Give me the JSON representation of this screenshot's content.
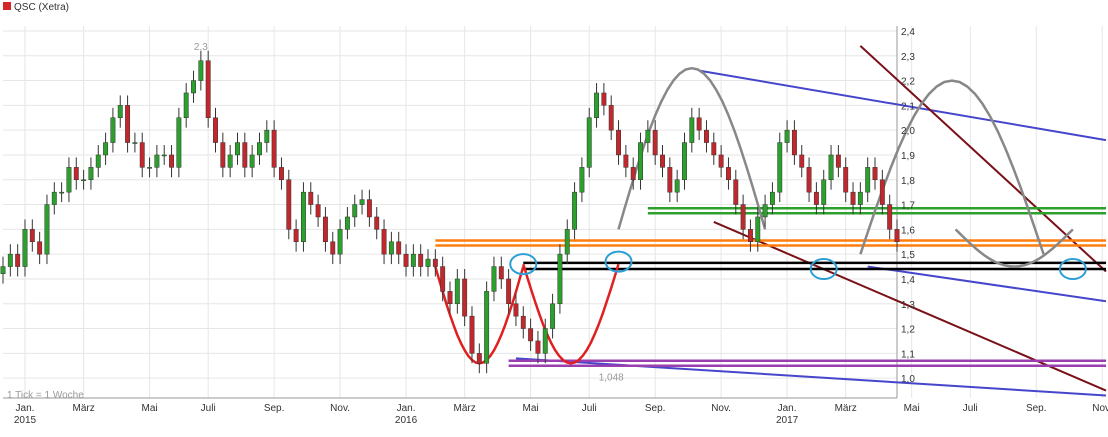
{
  "legend": {
    "label": "QSC (Xetra)",
    "color": "#d62728"
  },
  "footer_note": "1 Tick = 1 Woche",
  "chart_data": {
    "type": "candlestick",
    "title": "QSC (Xetra)",
    "ylim": [
      0.92,
      2.42
    ],
    "y_ticks": [
      "1,0",
      "1,1",
      "1,2",
      "1,3",
      "1,4",
      "1,5",
      "1,6",
      "1,7",
      "1,8",
      "1,9",
      "2,0",
      "2,1",
      "2,2",
      "2,3",
      "2,4"
    ],
    "y_tick_values": [
      1.0,
      1.1,
      1.2,
      1.3,
      1.4,
      1.5,
      1.6,
      1.7,
      1.8,
      1.9,
      2.0,
      2.1,
      2.2,
      2.3,
      2.4
    ],
    "x_month_labels": [
      "Jan.",
      "März",
      "Mai",
      "Juli",
      "Sep.",
      "Nov.",
      "Jan.",
      "März",
      "Mai",
      "Juli",
      "Sep.",
      "Nov.",
      "Jan.",
      "März",
      "Mai",
      "Juli",
      "Sep.",
      "Nov."
    ],
    "x_month_weeks": [
      3,
      11,
      20,
      28,
      37,
      46,
      55,
      63,
      72,
      80,
      89,
      98,
      107,
      115,
      124,
      132,
      141,
      150
    ],
    "x_year_labels": [
      "2015",
      "2016",
      "2017"
    ],
    "x_year_weeks": [
      3,
      55,
      107
    ],
    "annotations": [
      {
        "text": "2,3",
        "week": 27,
        "value": 2.3,
        "position": "above"
      },
      {
        "text": "1,048",
        "week": 83,
        "value": 1.048,
        "position": "below"
      }
    ],
    "series": [
      {
        "values": [
          1.45,
          1.5,
          1.45,
          1.6,
          1.55,
          1.5,
          1.7,
          1.75,
          1.75,
          1.85,
          1.8,
          1.8,
          1.85,
          1.9,
          1.95,
          2.05,
          2.1,
          1.95,
          1.95,
          1.85,
          1.85,
          1.9,
          1.9,
          1.85,
          2.05,
          2.15,
          2.2,
          2.28,
          2.05,
          1.95,
          1.85,
          1.9,
          1.95,
          1.85,
          1.9,
          1.95,
          2.0,
          1.85,
          1.8,
          1.6,
          1.55,
          1.75,
          1.7,
          1.65,
          1.55,
          1.5,
          1.6,
          1.65,
          1.7,
          1.72,
          1.65,
          1.6,
          1.5,
          1.55,
          1.5,
          1.45,
          1.5,
          1.45,
          1.48,
          1.45,
          1.35,
          1.3,
          1.4,
          1.25,
          1.1,
          1.06,
          1.35,
          1.45,
          1.4,
          1.3,
          1.25,
          1.2,
          1.15,
          1.1,
          1.2,
          1.3,
          1.5,
          1.6,
          1.75,
          1.85,
          2.05,
          2.15,
          2.1,
          2.0,
          1.9,
          1.85,
          1.8,
          1.95,
          2.0,
          1.9,
          1.85,
          1.75,
          1.8,
          1.95,
          2.05,
          2.0,
          1.95,
          1.9,
          1.85,
          1.8,
          1.7,
          1.6,
          1.55,
          1.65,
          1.7,
          1.75,
          1.95,
          2.0,
          1.9,
          1.85,
          1.75,
          1.7,
          1.8,
          1.9,
          1.85,
          1.75,
          1.7,
          1.75,
          1.85,
          1.8,
          1.7,
          1.6,
          1.55
        ]
      }
    ],
    "lines": [
      {
        "color": "#4646cc",
        "from": [
          95,
          2.24
        ],
        "to": [
          200,
          1.96
        ]
      },
      {
        "color": "#4646cc",
        "from": [
          118,
          1.45
        ],
        "to": [
          200,
          1.31
        ]
      },
      {
        "color": "#4646cc",
        "from": [
          70,
          1.08
        ],
        "to": [
          200,
          0.93
        ]
      },
      {
        "color": "#7a1018",
        "from": [
          117,
          2.34
        ],
        "to": [
          200,
          1.43
        ]
      },
      {
        "color": "#7a1018",
        "from": [
          97,
          1.63
        ],
        "to": [
          200,
          0.95
        ]
      },
      {
        "color": "#2ca02c",
        "from": [
          88,
          1.685
        ],
        "to": [
          200,
          1.685
        ]
      },
      {
        "color": "#2ca02c",
        "from": [
          88,
          1.665
        ],
        "to": [
          200,
          1.665
        ]
      },
      {
        "color": "#ff7f0e",
        "from": [
          59,
          1.555
        ],
        "to": [
          200,
          1.555
        ]
      },
      {
        "color": "#ff7f0e",
        "from": [
          59,
          1.535
        ],
        "to": [
          200,
          1.535
        ]
      },
      {
        "color": "#000000",
        "from": [
          71,
          1.465
        ],
        "to": [
          200,
          1.465
        ]
      },
      {
        "color": "#000000",
        "from": [
          71,
          1.44
        ],
        "to": [
          200,
          1.44
        ]
      },
      {
        "color": "#9b3fb0",
        "from": [
          69,
          1.07
        ],
        "to": [
          200,
          1.07
        ]
      },
      {
        "color": "#9b3fb0",
        "from": [
          69,
          1.05
        ],
        "to": [
          200,
          1.05
        ]
      }
    ],
    "grid": true,
    "legend_position": "top-left"
  }
}
